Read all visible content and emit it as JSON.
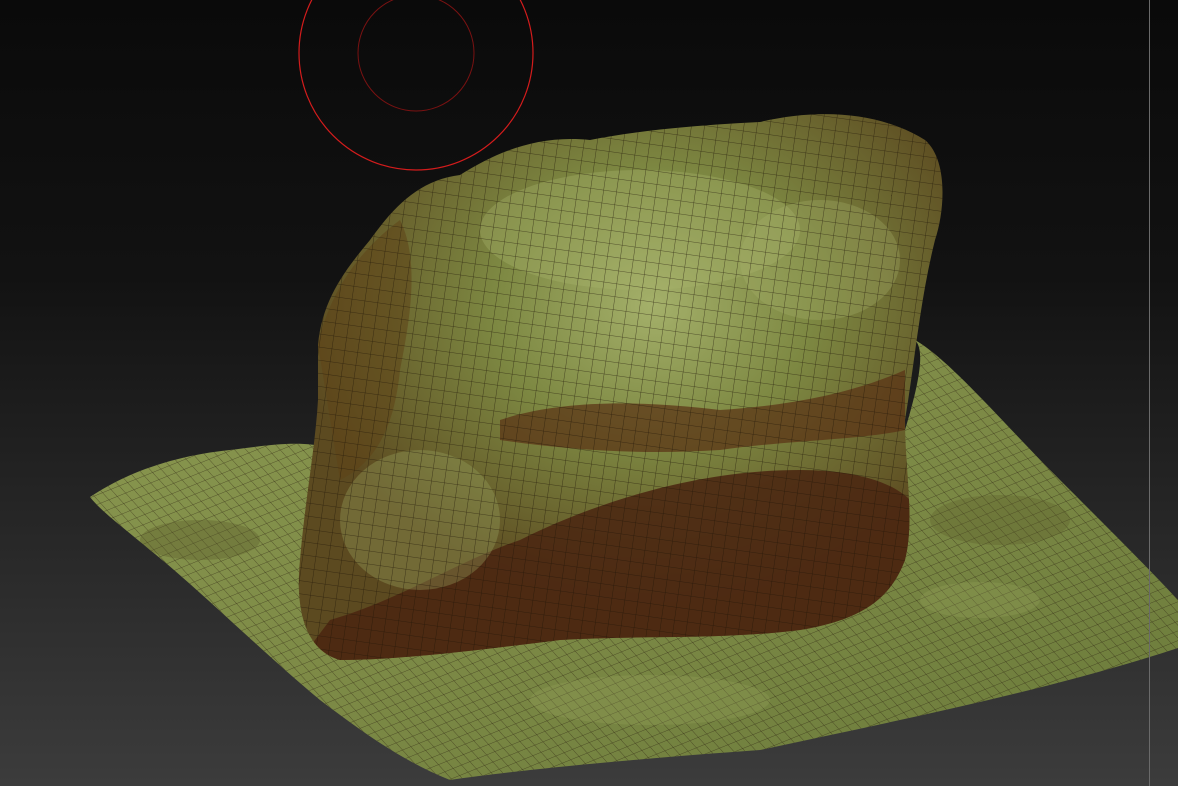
{
  "app": {
    "kind": "3d-sculpting-viewport"
  },
  "viewport": {
    "background_top": "#0b0b0b",
    "background_bottom": "#3a3a3a",
    "mesh": {
      "subject": "rock-on-terrain",
      "wireframe_visible": true,
      "base_color": "#6f7a3a",
      "highlight_color": "#9aa860",
      "shadow_color": "#4a2210",
      "wire_color": "#1e1408"
    },
    "brush_cursor": {
      "icon": "brush-cursor-icon",
      "color": "#d41c1c"
    }
  }
}
